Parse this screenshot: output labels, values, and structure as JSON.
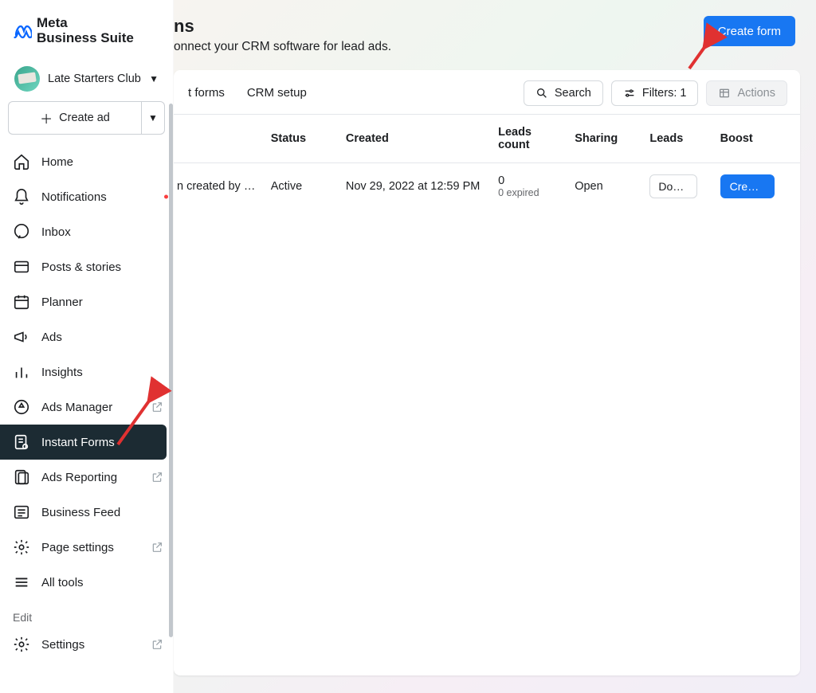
{
  "brand": {
    "line1": "Meta",
    "line2": "Business Suite"
  },
  "account": {
    "name": "Late Starters Club"
  },
  "create_ad": {
    "label": "Create ad"
  },
  "sidebar": {
    "items": [
      {
        "label": "Home"
      },
      {
        "label": "Notifications"
      },
      {
        "label": "Inbox"
      },
      {
        "label": "Posts & stories"
      },
      {
        "label": "Planner"
      },
      {
        "label": "Ads"
      },
      {
        "label": "Insights"
      },
      {
        "label": "Ads Manager"
      },
      {
        "label": "Instant Forms"
      },
      {
        "label": "Ads Reporting"
      },
      {
        "label": "Business Feed"
      },
      {
        "label": "Page settings"
      },
      {
        "label": "All tools"
      }
    ],
    "edit_label": "Edit",
    "settings_label": "Settings"
  },
  "header": {
    "title_fragment": "ns",
    "subtitle_fragment": "onnect your CRM software for lead ads.",
    "create_form": "Create form"
  },
  "tabs": {
    "forms_fragment": "t forms",
    "crm": "CRM setup"
  },
  "toolbar": {
    "search": "Search",
    "filters": "Filters: 1",
    "actions": "Actions"
  },
  "columns": {
    "status": "Status",
    "created": "Created",
    "leads_count_l1": "Leads",
    "leads_count_l2": "count",
    "sharing": "Sharing",
    "leads": "Leads",
    "boost": "Boost"
  },
  "rows": [
    {
      "name_fragment": "n created by …",
      "status": "Active",
      "created": "Nov 29, 2022 at 12:59 PM",
      "leads_count": "0",
      "leads_expired": "0 expired",
      "sharing": "Open",
      "download": "Dow…",
      "boost": "Creat…"
    }
  ]
}
